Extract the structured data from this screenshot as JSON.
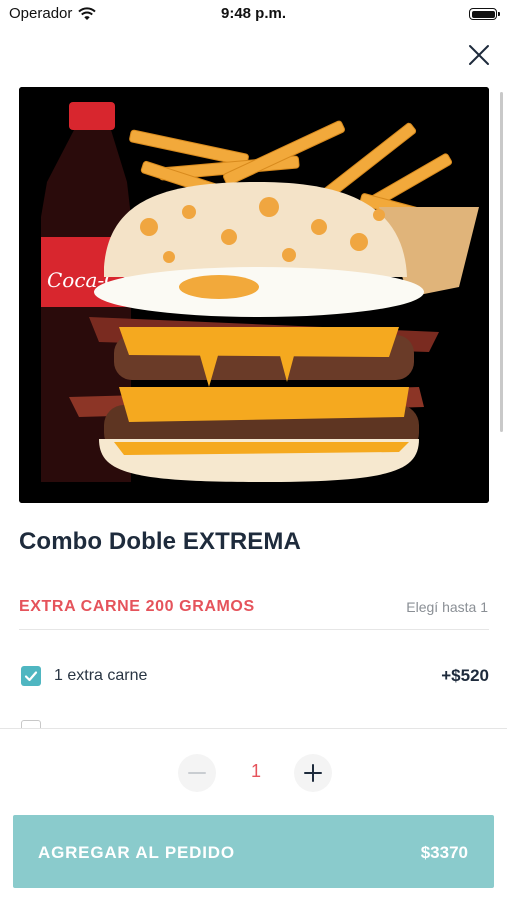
{
  "status_bar": {
    "carrier": "Operador",
    "time": "9:48 p.m."
  },
  "product": {
    "title": "Combo Doble EXTREMA",
    "image": "burger-combo-photo"
  },
  "option_group": {
    "title": "EXTRA CARNE 200 GRAMOS",
    "hint": "Elegí hasta 1",
    "options": [
      {
        "label": "1 extra carne",
        "price": "+$520",
        "checked": true
      },
      {
        "label": "",
        "price": "",
        "checked": false
      }
    ]
  },
  "quantity": {
    "value": "1",
    "minus_icon": "minus-icon",
    "plus_icon": "plus-icon"
  },
  "cta": {
    "label": "AGREGAR AL PEDIDO",
    "total": "$3370"
  },
  "colors": {
    "accent_red": "#e5535b",
    "teal": "#4fb6c1",
    "button_teal": "#8acbcc",
    "title_dark": "#1e2b3c"
  }
}
